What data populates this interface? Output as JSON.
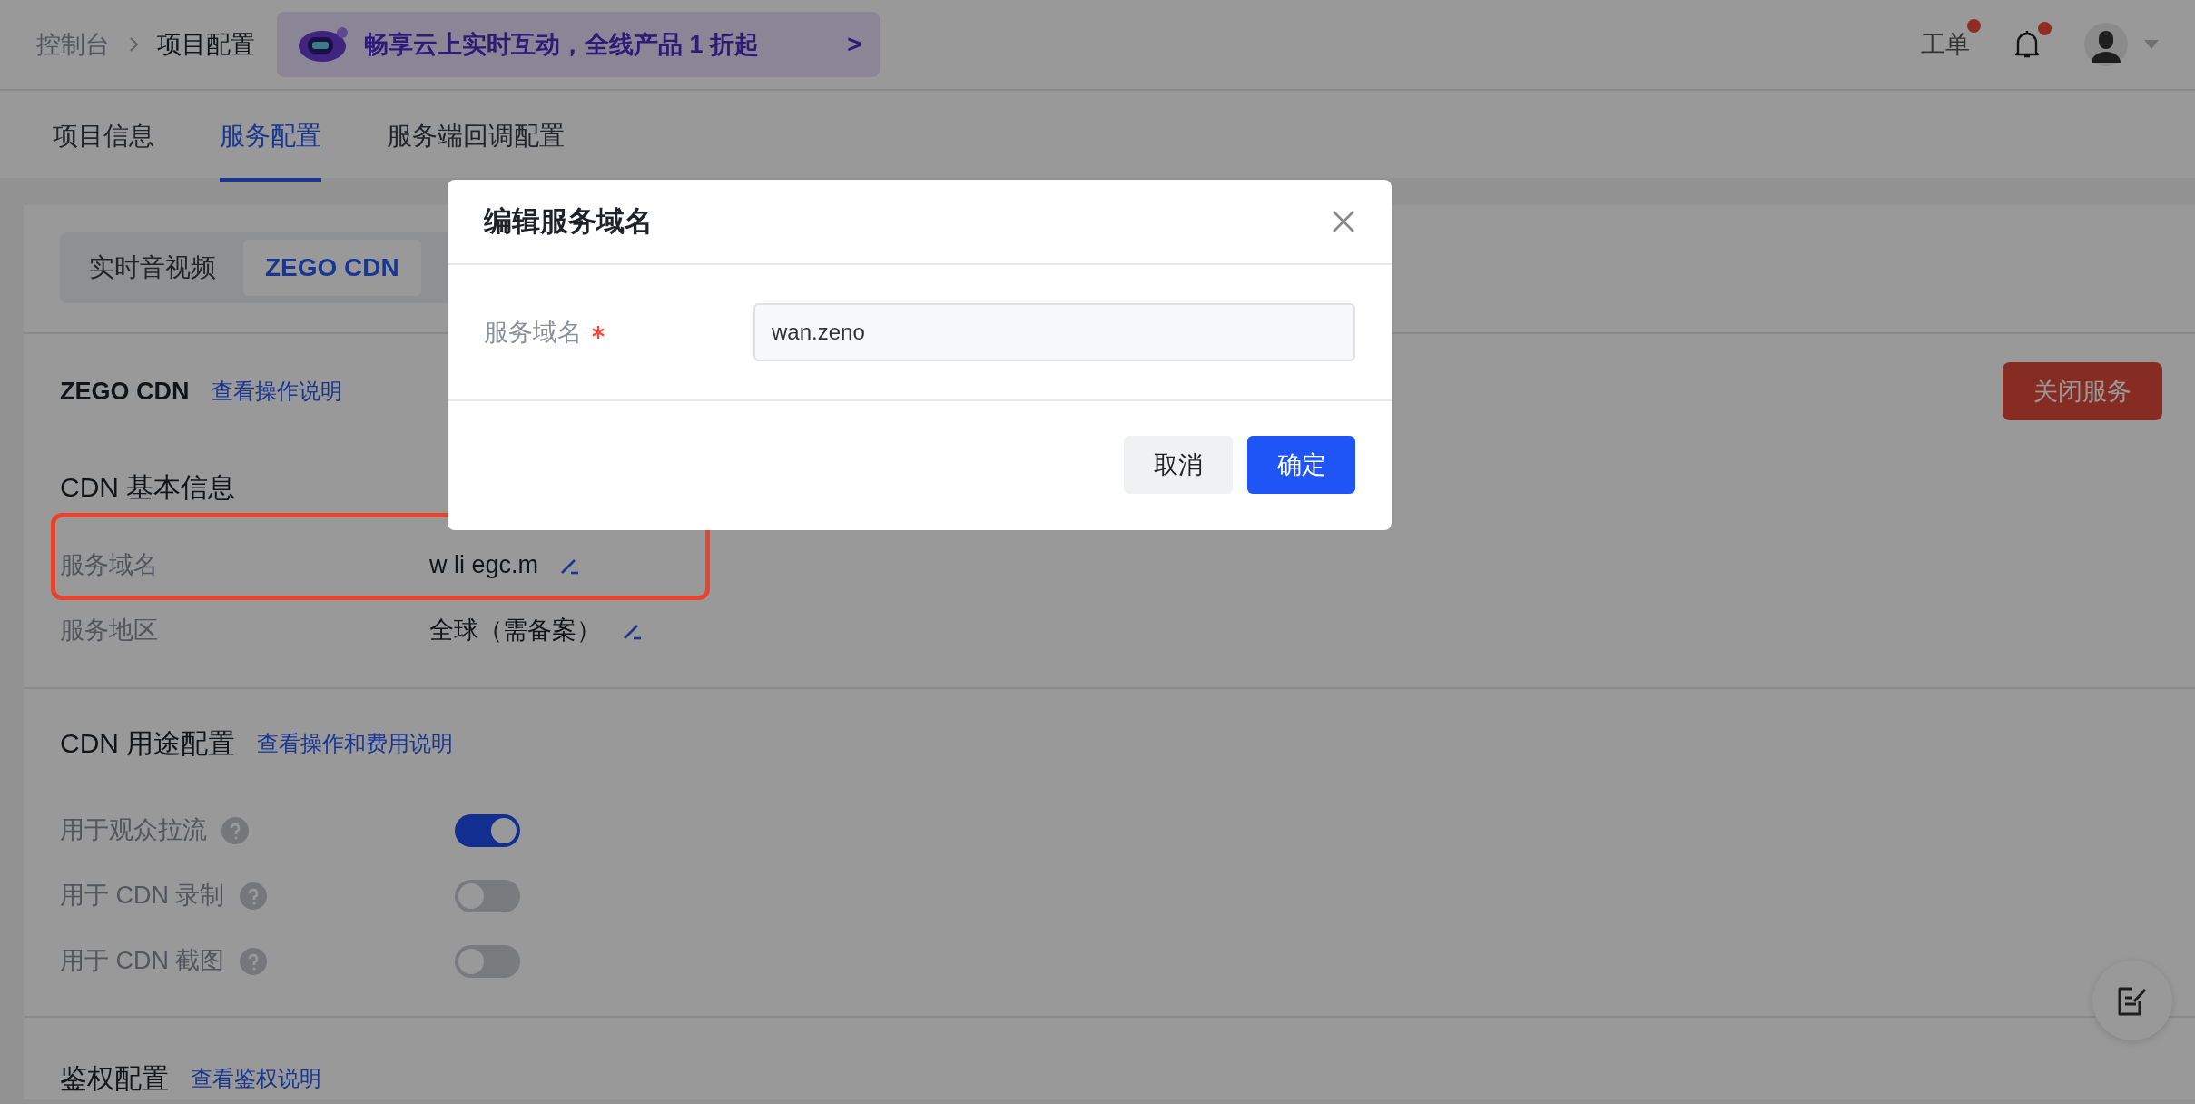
{
  "breadcrumb": [
    {
      "label": "控制台"
    },
    {
      "label": "项目配置"
    }
  ],
  "promo_banner": {
    "text": "畅享云上实时互动，全线产品 1 折起",
    "arrow": ">"
  },
  "header_actions": {
    "ticket": {
      "label": "工单",
      "badge": true
    },
    "notifications": {
      "badge": true
    }
  },
  "tabs": [
    {
      "label": "项目信息",
      "selected": false
    },
    {
      "label": "服务配置",
      "selected": true
    },
    {
      "label": "服务端回调配置",
      "selected": false
    }
  ],
  "service_tabs": [
    {
      "label": "实时音视频",
      "selected": false
    },
    {
      "label": "ZEGO CDN",
      "selected": true
    }
  ],
  "cdn_section": {
    "title": "ZEGO CDN",
    "help_link": "查看操作说明",
    "close_button": "关闭服务"
  },
  "basic_info": {
    "title": "CDN 基本信息",
    "fields": [
      {
        "label": "服务域名",
        "value": "w li egc.m",
        "highlighted": true
      },
      {
        "label": "服务地区",
        "value": "全球（需备案）",
        "highlighted": false
      }
    ]
  },
  "usage_config": {
    "title": "CDN 用途配置",
    "help_link": "查看操作和费用说明",
    "toggles": [
      {
        "label": "用于观众拉流",
        "on": true
      },
      {
        "label": "用于 CDN 录制",
        "on": false
      },
      {
        "label": "用于 CDN 截图",
        "on": false
      }
    ]
  },
  "auth_config": {
    "title": "鉴权配置",
    "help_link": "查看鉴权说明"
  },
  "dialog": {
    "title": "编辑服务域名",
    "field": {
      "label": "服务域名",
      "required": true,
      "value": "wan.zeno"
    },
    "buttons": [
      {
        "label": "取消",
        "kind": "secondary"
      },
      {
        "label": "确定",
        "kind": "primary"
      }
    ]
  }
}
